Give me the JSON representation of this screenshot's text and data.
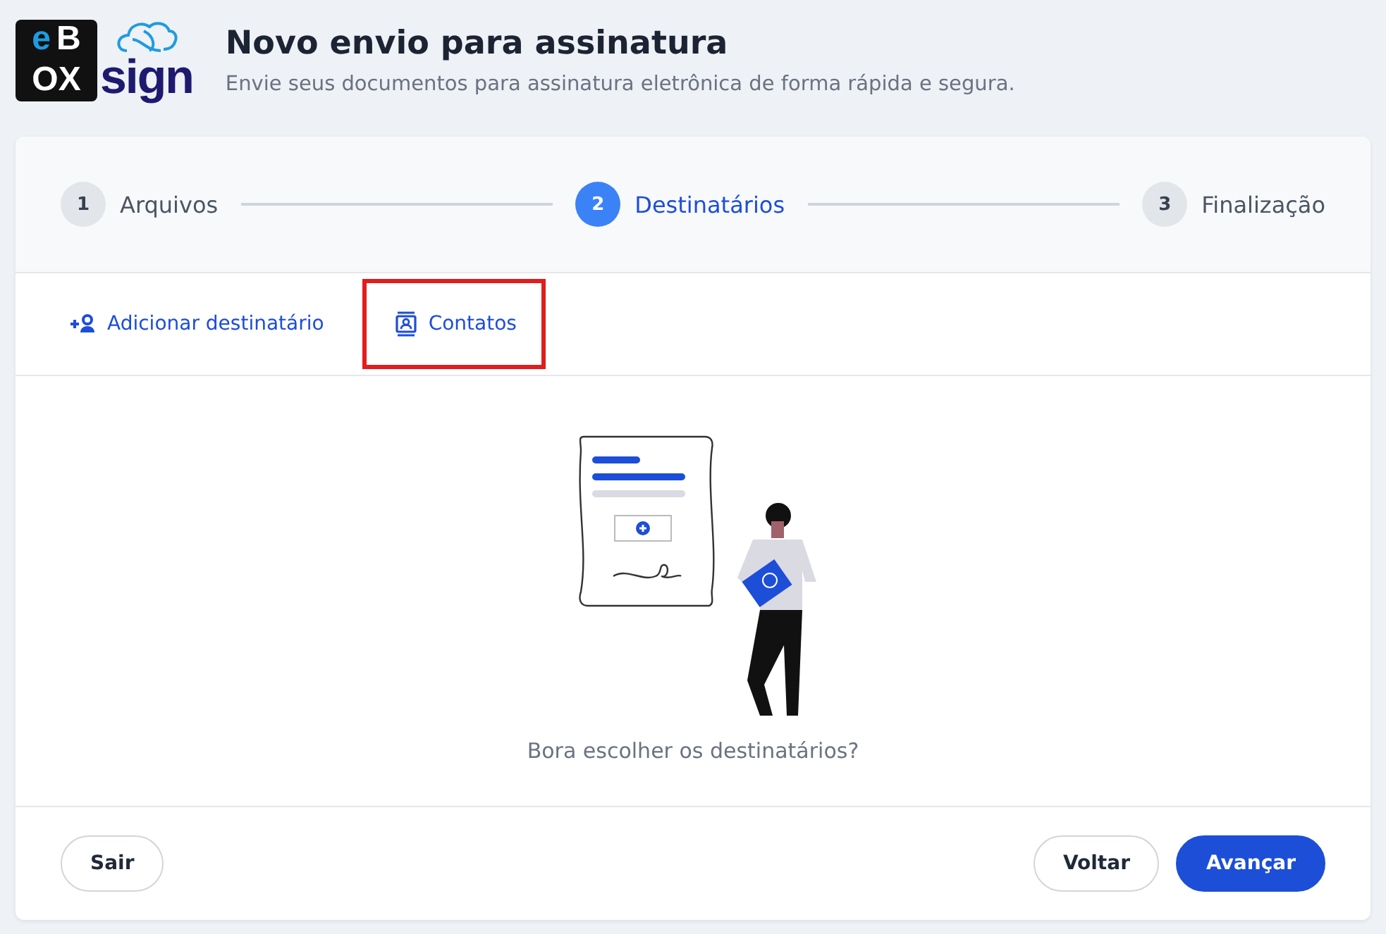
{
  "logo": {
    "box_top": [
      "e",
      "B"
    ],
    "box_bottom": "OX",
    "word": "sign"
  },
  "header": {
    "title": "Novo envio para assinatura",
    "subtitle": "Envie seus documentos para assinatura eletrônica de forma rápida e segura."
  },
  "steps": [
    {
      "number": "1",
      "label": "Arquivos",
      "selected": false
    },
    {
      "number": "2",
      "label": "Destinatários",
      "selected": true
    },
    {
      "number": "3",
      "label": "Finalização",
      "selected": false
    }
  ],
  "actions": [
    {
      "kind": "add-person",
      "label": "Adicionar destinatário",
      "highlighted": false
    },
    {
      "kind": "contacts",
      "label": "Contatos",
      "highlighted": true
    }
  ],
  "empty_state": {
    "message": "Bora escolher os destinatários?"
  },
  "footer": {
    "left": [
      {
        "label": "Sair",
        "kind": "outline"
      }
    ],
    "right": [
      {
        "label": "Voltar",
        "kind": "outline"
      },
      {
        "label": "Avançar",
        "kind": "primary"
      }
    ]
  }
}
